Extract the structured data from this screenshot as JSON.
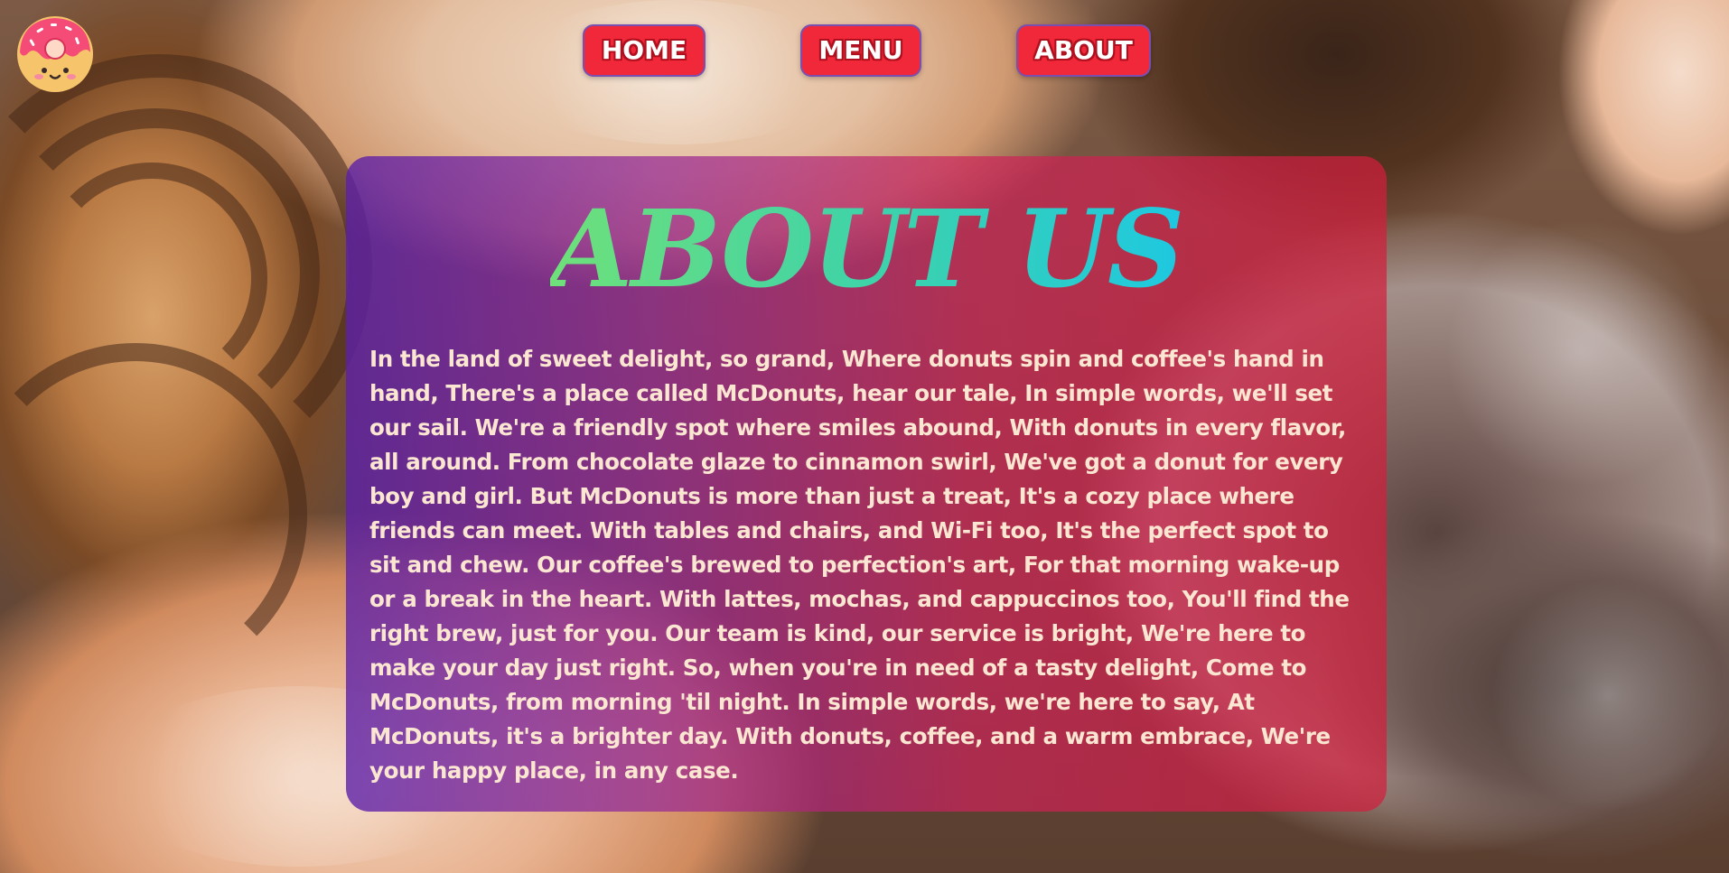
{
  "nav": {
    "items": [
      {
        "label": "HOME"
      },
      {
        "label": "MENU"
      },
      {
        "label": "ABOUT"
      }
    ]
  },
  "logo": {
    "icon": "donut-icon"
  },
  "main": {
    "title": "ABOUT US",
    "body": "In the land of sweet delight, so grand, Where donuts spin and coffee's hand in hand, There's a place called McDonuts, hear our tale, In simple words, we'll set our sail. We're a friendly spot where smiles abound, With donuts in every flavor, all around. From chocolate glaze to cinnamon swirl, We've got a donut for every boy and girl. But McDonuts is more than just a treat, It's a cozy place where friends can meet. With tables and chairs, and Wi-Fi too, It's the perfect spot to sit and chew. Our coffee's brewed to perfection's art, For that morning wake-up or a break in the heart. With lattes, mochas, and cappuccinos too, You'll find the right brew, just for you. Our team is kind, our service is bright, We're here to make your day just right. So, when you're in need of a tasty delight, Come to McDonuts, from morning 'til night. In simple words, we're here to say, At McDonuts, it's a brighter day. With donuts, coffee, and a warm embrace, We're your happy place, in any case."
  },
  "colors": {
    "nav_button": "#f0283a",
    "nav_border": "#7a4fb0",
    "title_gradient_start": "#6fe07a",
    "title_gradient_end": "#1ec8e0",
    "body_text": "#fbe6d2"
  }
}
